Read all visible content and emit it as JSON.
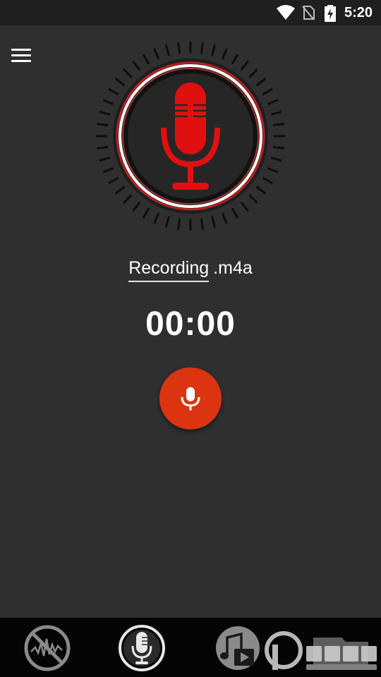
{
  "status_bar": {
    "time": "5:20",
    "icons": [
      "wifi-icon",
      "no-sim-icon",
      "battery-charging-icon"
    ]
  },
  "toolbar": {
    "menu_icon": "hamburger-menu-icon"
  },
  "recording": {
    "file_name": "Recording",
    "extension": ".m4a",
    "timer": "00:00",
    "record_icon": "microphone-icon"
  },
  "bottom_nav": {
    "items": [
      {
        "icon": "noise-off-icon"
      },
      {
        "icon": "microphone-icon",
        "selected": true
      },
      {
        "icon": "media-files-icon"
      }
    ]
  },
  "colors": {
    "background": "#2f2f2f",
    "accent_red": "#dc3411",
    "mic_red": "#e01010",
    "nav_bg": "#050505"
  }
}
